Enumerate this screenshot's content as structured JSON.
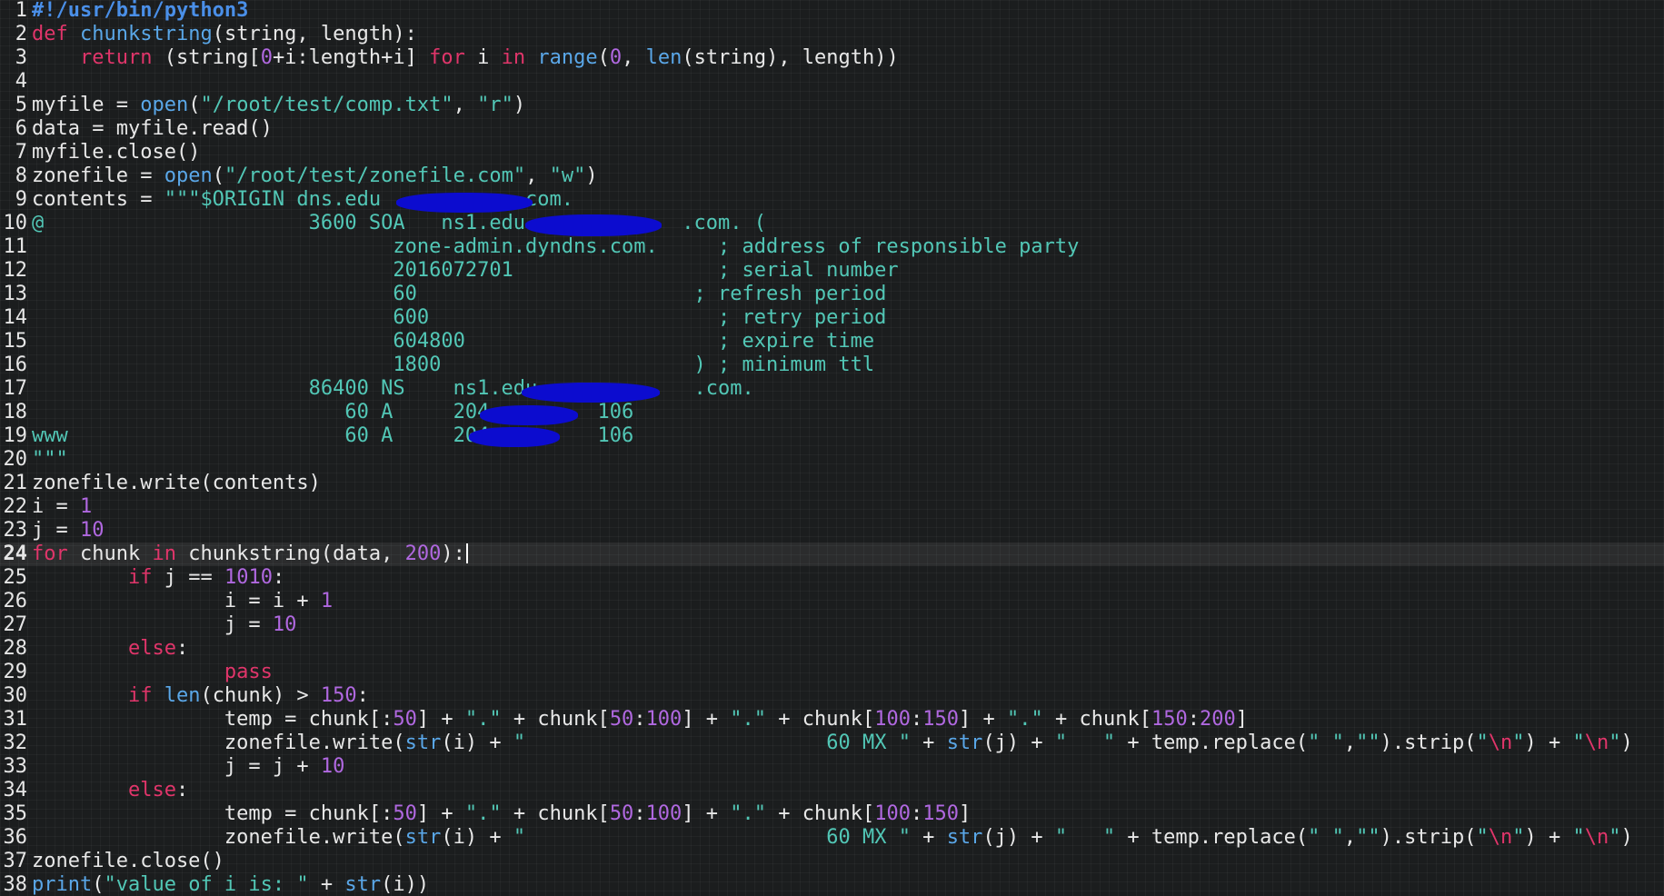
{
  "colors": {
    "background": "#1b1d1e",
    "plain": "#e8e8e8",
    "keyword": "#e0356a",
    "builtin": "#5aa7e8",
    "string": "#52c7b6",
    "number": "#b068e0",
    "shebang": "#4a8fe8",
    "redaction": "#0c0ccf"
  },
  "editor": {
    "current_line": 24,
    "lines": [
      {
        "n": "1",
        "tokens": [
          {
            "t": "#!/usr/bin/python3",
            "k": "shebang"
          }
        ]
      },
      {
        "n": "2",
        "tokens": [
          {
            "t": "def",
            "k": "keyword"
          },
          {
            "t": " "
          },
          {
            "t": "chunkstring",
            "k": "builtin"
          },
          {
            "t": "(string, length):"
          }
        ]
      },
      {
        "n": "3",
        "tokens": [
          {
            "t": "    "
          },
          {
            "t": "return",
            "k": "keyword"
          },
          {
            "t": " (string["
          },
          {
            "t": "0",
            "k": "number"
          },
          {
            "t": "+i:length+i] "
          },
          {
            "t": "for",
            "k": "keyword"
          },
          {
            "t": " i "
          },
          {
            "t": "in",
            "k": "keyword"
          },
          {
            "t": " "
          },
          {
            "t": "range",
            "k": "builtin"
          },
          {
            "t": "("
          },
          {
            "t": "0",
            "k": "number"
          },
          {
            "t": ", "
          },
          {
            "t": "len",
            "k": "builtin"
          },
          {
            "t": "(string), length))"
          }
        ]
      },
      {
        "n": "4",
        "tokens": []
      },
      {
        "n": "5",
        "tokens": [
          {
            "t": "myfile = "
          },
          {
            "t": "open",
            "k": "builtin"
          },
          {
            "t": "("
          },
          {
            "t": "\"/root/test/comp.txt\"",
            "k": "string"
          },
          {
            "t": ", "
          },
          {
            "t": "\"r\"",
            "k": "string"
          },
          {
            "t": ")"
          }
        ]
      },
      {
        "n": "6",
        "tokens": [
          {
            "t": "data = myfile.read()"
          }
        ]
      },
      {
        "n": "7",
        "tokens": [
          {
            "t": "myfile.close()"
          }
        ]
      },
      {
        "n": "8",
        "tokens": [
          {
            "t": "zonefile = "
          },
          {
            "t": "open",
            "k": "builtin"
          },
          {
            "t": "("
          },
          {
            "t": "\"/root/test/zonefile.com\"",
            "k": "string"
          },
          {
            "t": ", "
          },
          {
            "t": "\"w\"",
            "k": "string"
          },
          {
            "t": ")"
          }
        ]
      },
      {
        "n": "9",
        "tokens": [
          {
            "t": "contents = "
          },
          {
            "t": "\"\"\"$ORIGIN dns.edu           .com.",
            "k": "string"
          }
        ]
      },
      {
        "n": "10",
        "tokens": [
          {
            "t": "@                      3600 SOA   ns1.edu             .com. (",
            "k": "string"
          }
        ]
      },
      {
        "n": "11",
        "tokens": [
          {
            "t": "                              zone-admin.dyndns.com.     ; address of responsible party",
            "k": "string"
          }
        ]
      },
      {
        "n": "12",
        "tokens": [
          {
            "t": "                              2016072701                 ; serial number",
            "k": "string"
          }
        ]
      },
      {
        "n": "13",
        "tokens": [
          {
            "t": "                              60                       ; refresh period",
            "k": "string"
          }
        ]
      },
      {
        "n": "14",
        "tokens": [
          {
            "t": "                              600                        ; retry period",
            "k": "string"
          }
        ]
      },
      {
        "n": "15",
        "tokens": [
          {
            "t": "                              604800                     ; expire time",
            "k": "string"
          }
        ]
      },
      {
        "n": "16",
        "tokens": [
          {
            "t": "                              1800                     ) ; minimum ttl",
            "k": "string"
          }
        ]
      },
      {
        "n": "17",
        "tokens": [
          {
            "t": "                       86400 NS    ns1.edu             .com.",
            "k": "string"
          }
        ]
      },
      {
        "n": "18",
        "tokens": [
          {
            "t": "                          60 A     204.        106",
            "k": "string"
          }
        ]
      },
      {
        "n": "19",
        "tokens": [
          {
            "t": "www                       60 A     204.        106",
            "k": "string"
          }
        ]
      },
      {
        "n": "20",
        "tokens": [
          {
            "t": "\"\"\"",
            "k": "string"
          }
        ]
      },
      {
        "n": "21",
        "tokens": [
          {
            "t": "zonefile.write(contents)"
          }
        ]
      },
      {
        "n": "22",
        "tokens": [
          {
            "t": "i = "
          },
          {
            "t": "1",
            "k": "number"
          }
        ]
      },
      {
        "n": "23",
        "tokens": [
          {
            "t": "j = "
          },
          {
            "t": "10",
            "k": "number"
          }
        ]
      },
      {
        "n": "24",
        "tokens": [
          {
            "t": "for",
            "k": "keyword"
          },
          {
            "t": " chunk "
          },
          {
            "t": "in",
            "k": "keyword"
          },
          {
            "t": " chunkstring(data, "
          },
          {
            "t": "200",
            "k": "number"
          },
          {
            "t": "):"
          }
        ],
        "cursor": true
      },
      {
        "n": "25",
        "tokens": [
          {
            "t": "        "
          },
          {
            "t": "if",
            "k": "keyword"
          },
          {
            "t": " j == "
          },
          {
            "t": "1010",
            "k": "number"
          },
          {
            "t": ":"
          }
        ]
      },
      {
        "n": "26",
        "tokens": [
          {
            "t": "                i = i + "
          },
          {
            "t": "1",
            "k": "number"
          }
        ]
      },
      {
        "n": "27",
        "tokens": [
          {
            "t": "                j = "
          },
          {
            "t": "10",
            "k": "number"
          }
        ]
      },
      {
        "n": "28",
        "tokens": [
          {
            "t": "        "
          },
          {
            "t": "else",
            "k": "keyword"
          },
          {
            "t": ":"
          }
        ]
      },
      {
        "n": "29",
        "tokens": [
          {
            "t": "                "
          },
          {
            "t": "pass",
            "k": "keyword"
          }
        ]
      },
      {
        "n": "30",
        "tokens": [
          {
            "t": "        "
          },
          {
            "t": "if",
            "k": "keyword"
          },
          {
            "t": " "
          },
          {
            "t": "len",
            "k": "builtin"
          },
          {
            "t": "(chunk) > "
          },
          {
            "t": "150",
            "k": "number"
          },
          {
            "t": ":"
          }
        ]
      },
      {
        "n": "31",
        "tokens": [
          {
            "t": "                temp = chunk[:"
          },
          {
            "t": "50",
            "k": "number"
          },
          {
            "t": "] + "
          },
          {
            "t": "\".\"",
            "k": "string"
          },
          {
            "t": " + chunk["
          },
          {
            "t": "50",
            "k": "number"
          },
          {
            "t": ":"
          },
          {
            "t": "100",
            "k": "number"
          },
          {
            "t": "] + "
          },
          {
            "t": "\".\"",
            "k": "string"
          },
          {
            "t": " + chunk["
          },
          {
            "t": "100",
            "k": "number"
          },
          {
            "t": ":"
          },
          {
            "t": "150",
            "k": "number"
          },
          {
            "t": "] + "
          },
          {
            "t": "\".\"",
            "k": "string"
          },
          {
            "t": " + chunk["
          },
          {
            "t": "150",
            "k": "number"
          },
          {
            "t": ":"
          },
          {
            "t": "200",
            "k": "number"
          },
          {
            "t": "]"
          }
        ]
      },
      {
        "n": "32",
        "tokens": [
          {
            "t": "                zonefile.write("
          },
          {
            "t": "str",
            "k": "builtin"
          },
          {
            "t": "(i) + "
          },
          {
            "t": "\"                         60 MX \"",
            "k": "string"
          },
          {
            "t": " + "
          },
          {
            "t": "str",
            "k": "builtin"
          },
          {
            "t": "(j) + "
          },
          {
            "t": "\"   \"",
            "k": "string"
          },
          {
            "t": " + temp.replace("
          },
          {
            "t": "\" \"",
            "k": "string"
          },
          {
            "t": ","
          },
          {
            "t": "\"\"",
            "k": "string"
          },
          {
            "t": ").strip("
          },
          {
            "t": "\"",
            "k": "string"
          },
          {
            "t": "\\n",
            "k": "keyword"
          },
          {
            "t": "\"",
            "k": "string"
          },
          {
            "t": ") + "
          },
          {
            "t": "\"",
            "k": "string"
          },
          {
            "t": "\\n",
            "k": "keyword"
          },
          {
            "t": "\"",
            "k": "string"
          },
          {
            "t": ")"
          }
        ]
      },
      {
        "n": "33",
        "tokens": [
          {
            "t": "                j = j + "
          },
          {
            "t": "10",
            "k": "number"
          }
        ]
      },
      {
        "n": "34",
        "tokens": [
          {
            "t": "        "
          },
          {
            "t": "else",
            "k": "keyword"
          },
          {
            "t": ":"
          }
        ]
      },
      {
        "n": "35",
        "tokens": [
          {
            "t": "                temp = chunk[:"
          },
          {
            "t": "50",
            "k": "number"
          },
          {
            "t": "] + "
          },
          {
            "t": "\".\"",
            "k": "string"
          },
          {
            "t": " + chunk["
          },
          {
            "t": "50",
            "k": "number"
          },
          {
            "t": ":"
          },
          {
            "t": "100",
            "k": "number"
          },
          {
            "t": "] + "
          },
          {
            "t": "\".\"",
            "k": "string"
          },
          {
            "t": " + chunk["
          },
          {
            "t": "100",
            "k": "number"
          },
          {
            "t": ":"
          },
          {
            "t": "150",
            "k": "number"
          },
          {
            "t": "]"
          }
        ]
      },
      {
        "n": "36",
        "tokens": [
          {
            "t": "                zonefile.write("
          },
          {
            "t": "str",
            "k": "builtin"
          },
          {
            "t": "(i) + "
          },
          {
            "t": "\"                         60 MX \"",
            "k": "string"
          },
          {
            "t": " + "
          },
          {
            "t": "str",
            "k": "builtin"
          },
          {
            "t": "(j) + "
          },
          {
            "t": "\"   \"",
            "k": "string"
          },
          {
            "t": " + temp.replace("
          },
          {
            "t": "\" \"",
            "k": "string"
          },
          {
            "t": ","
          },
          {
            "t": "\"\"",
            "k": "string"
          },
          {
            "t": ").strip("
          },
          {
            "t": "\"",
            "k": "string"
          },
          {
            "t": "\\n",
            "k": "keyword"
          },
          {
            "t": "\"",
            "k": "string"
          },
          {
            "t": ") + "
          },
          {
            "t": "\"",
            "k": "string"
          },
          {
            "t": "\\n",
            "k": "keyword"
          },
          {
            "t": "\"",
            "k": "string"
          },
          {
            "t": ")"
          }
        ]
      },
      {
        "n": "37",
        "tokens": [
          {
            "t": "zonefile.close()"
          }
        ]
      },
      {
        "n": "38",
        "tokens": [
          {
            "t": "print",
            "k": "builtin"
          },
          {
            "t": "("
          },
          {
            "t": "\"value of i is: \"",
            "k": "string"
          },
          {
            "t": " + "
          },
          {
            "t": "str",
            "k": "builtin"
          },
          {
            "t": "(i))"
          }
        ]
      }
    ]
  }
}
